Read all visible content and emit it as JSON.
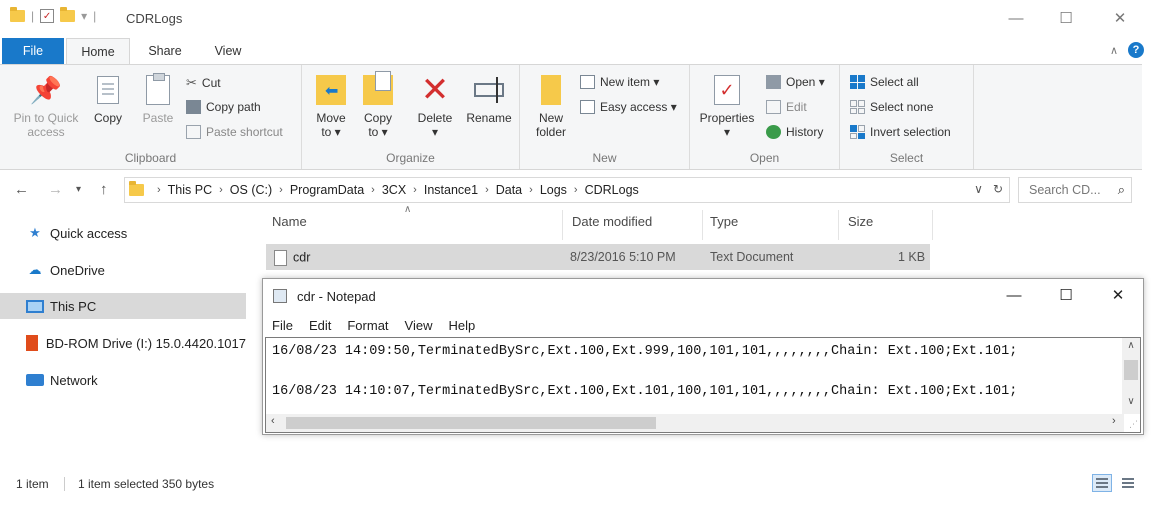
{
  "window": {
    "title": "CDRLogs",
    "minimize": "—",
    "maximize": "☐",
    "close": "✕"
  },
  "ribbon_tabs": {
    "file": "File",
    "home": "Home",
    "share": "Share",
    "view": "View"
  },
  "clipboard": {
    "pin": "Pin to Quick",
    "pin2": "access",
    "copy": "Copy",
    "paste": "Paste",
    "cut": "Cut",
    "copy_path": "Copy path",
    "paste_shortcut": "Paste shortcut",
    "label": "Clipboard"
  },
  "organize": {
    "move": "Move",
    "move2": "to ▾",
    "copy": "Copy",
    "copy2": "to ▾",
    "delete": "Delete",
    "delete2": "▾",
    "rename": "Rename",
    "label": "Organize"
  },
  "new_group": {
    "new_folder": "New",
    "new_folder2": "folder",
    "new_item": "New item ▾",
    "easy_access": "Easy access ▾",
    "label": "New"
  },
  "open_group": {
    "properties": "Properties",
    "properties2": "▾",
    "open": "Open ▾",
    "edit": "Edit",
    "history": "History",
    "label": "Open"
  },
  "select_group": {
    "select_all": "Select all",
    "select_none": "Select none",
    "invert": "Invert selection",
    "label": "Select"
  },
  "address": {
    "crumbs": [
      "This PC",
      "OS (C:)",
      "ProgramData",
      "3CX",
      "Instance1",
      "Data",
      "Logs",
      "CDRLogs"
    ],
    "search_placeholder": "Search CD..."
  },
  "nav_pane": {
    "quick_access": "Quick access",
    "onedrive": "OneDrive",
    "this_pc": "This PC",
    "bdrom": "BD-ROM Drive (I:) 15.0.4420.1017",
    "network": "Network"
  },
  "file_list": {
    "columns": {
      "name": "Name",
      "date": "Date modified",
      "type": "Type",
      "size": "Size"
    },
    "rows": [
      {
        "name": "cdr",
        "date": "8/23/2016 5:10 PM",
        "type": "Text Document",
        "size": "1 KB"
      }
    ]
  },
  "notepad": {
    "title": "cdr - Notepad",
    "menu": [
      "File",
      "Edit",
      "Format",
      "View",
      "Help"
    ],
    "lines": [
      "16/08/23 14:09:50,TerminatedBySrc,Ext.100,Ext.999,100,101,101,,,,,,,,Chain: Ext.100;Ext.101;",
      "16/08/23 14:10:07,TerminatedBySrc,Ext.100,Ext.101,100,101,101,,,,,,,,Chain: Ext.100;Ext.101;"
    ]
  },
  "status": {
    "items": "1 item",
    "selected": "1 item selected  350 bytes"
  },
  "colors": {
    "accent": "#1979ca",
    "folder": "#f6c94a",
    "delete": "#d32f2f",
    "selection": "#d9d9d9"
  }
}
